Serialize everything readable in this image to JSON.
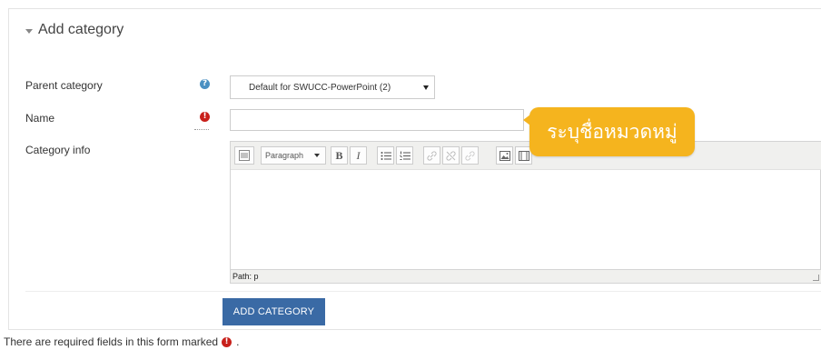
{
  "form": {
    "legend": "Add category",
    "parent_category": {
      "label": "Parent category",
      "selected": "Default for SWUCC-PowerPoint (2)"
    },
    "name": {
      "label": "Name",
      "value": ""
    },
    "category_info": {
      "label": "Category info",
      "format_select": "Paragraph",
      "bold_label": "B",
      "italic_label": "I",
      "path_text": "Path: p"
    },
    "submit_label": "ADD CATEGORY",
    "required_note": "There are required fields in this form marked",
    "required_note_end": "."
  },
  "callout": {
    "text": "ระบุชื่อหมวดหมู่"
  },
  "colors": {
    "submit": "#3a6aa5",
    "required": "#c8201b",
    "help": "#4a90c2",
    "callout": "#f5b41e"
  },
  "icons": {
    "help": "question-circle-icon",
    "required": "exclamation-circle-icon"
  }
}
